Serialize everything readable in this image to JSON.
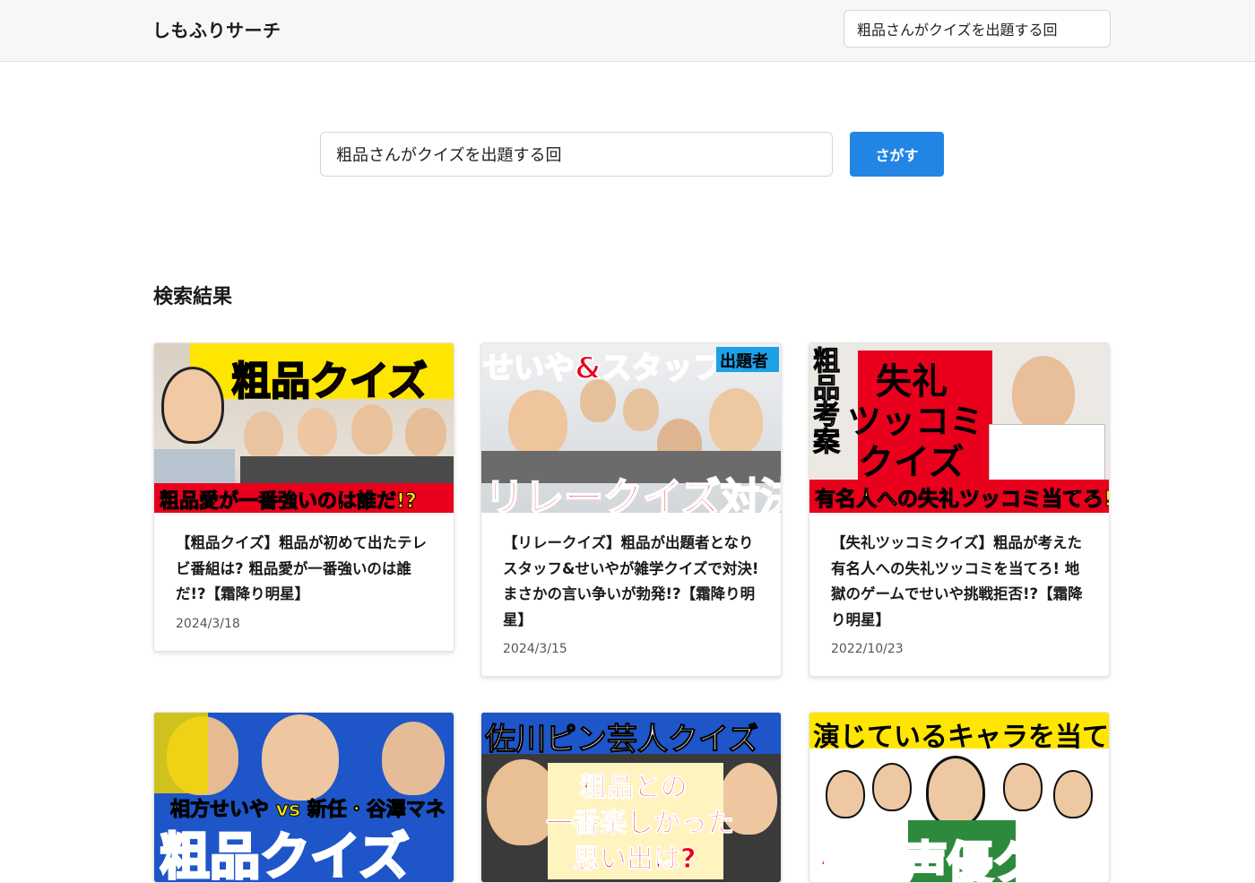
{
  "header": {
    "brand": "しもふりサーチ",
    "search_value": "粗品さんがクイズを出題する回"
  },
  "search": {
    "value": "粗品さんがクイズを出題する回",
    "button_label": "さがす"
  },
  "results": {
    "heading": "検索結果",
    "cards": [
      {
        "thumb_text_main": "粗品クイズ",
        "thumb_text_sub": "粗品愛が一番強いのは誰だ!?",
        "title": "【粗品クイズ】粗品が初めて出たテレビ番組は? 粗品愛が一番強いのは誰だ!?【霜降り明星】",
        "date": "2024/3/18"
      },
      {
        "thumb_text_main": "せいや&スタッフ",
        "thumb_text_badge": "出題者",
        "thumb_text_sub": "リレークイズ対決",
        "title": "【リレークイズ】粗品が出題者となりスタッフ&せいやが雑学クイズで対決! まさかの言い争いが勃発!?【霜降り明星】",
        "date": "2024/3/15"
      },
      {
        "thumb_text_side": "粗品考案",
        "thumb_text_main1": "失礼",
        "thumb_text_main2": "ツッコミ",
        "thumb_text_main3": "クイズ",
        "thumb_text_sub": "有名人への失礼ツッコミ当てろ!",
        "title": "【失礼ツッコミクイズ】粗品が考えた有名人への失礼ツッコミを当てろ! 地獄のゲームでせいや挑戦拒否!?【霜降り明星】",
        "date": "2022/10/23"
      },
      {
        "thumb_text_sub": "相方せいや vs 新任・谷澤マネ",
        "thumb_text_main": "粗品クイズ"
      },
      {
        "thumb_text_main": "佐川ピン芸人クイズ",
        "thumb_text_sub1": "粗品との",
        "thumb_text_sub2": "一番楽しかった",
        "thumb_text_sub3": "思い出は?"
      },
      {
        "thumb_text_main": "演じているキャラを当てろ",
        "thumb_text_sub": "粗品声優クイズ"
      }
    ]
  },
  "colors": {
    "accent": "#2285e4",
    "thumb_yellow": "#ffe600",
    "thumb_red": "#e8001c",
    "thumb_blue": "#1e55c8"
  }
}
